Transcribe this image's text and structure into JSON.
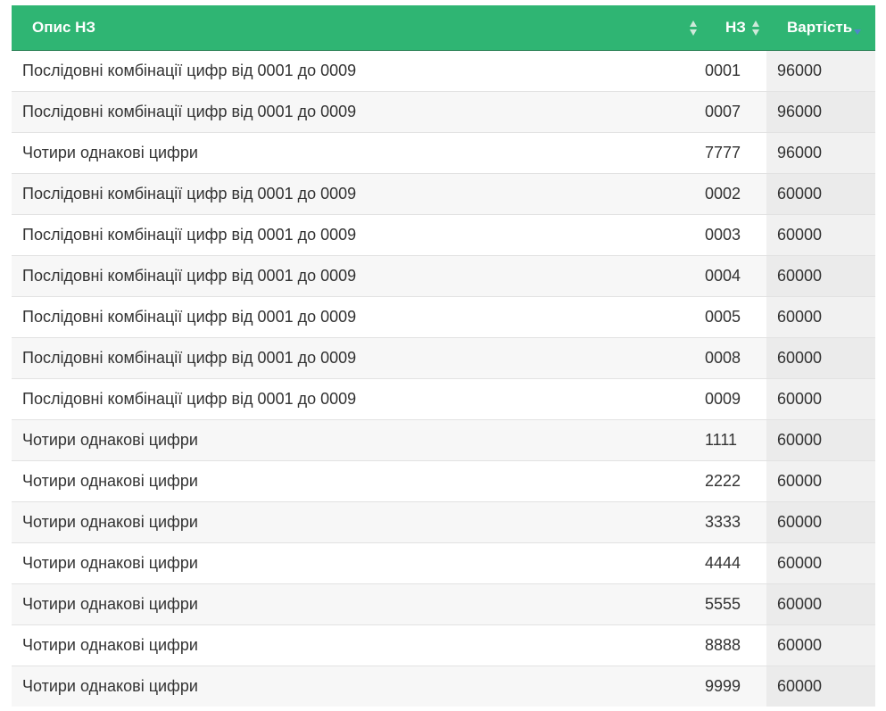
{
  "table": {
    "headers": {
      "description": "Опис НЗ",
      "nz": "НЗ",
      "cost": "Вартість"
    },
    "sort": {
      "column": "cost",
      "direction": "descending"
    },
    "colors": {
      "header_background": "#2fb573",
      "header_text": "#ffffff",
      "active_sort_arrow": "#4f86c9"
    },
    "rows": [
      {
        "description": "Послідовні комбінації цифр від 0001 до 0009",
        "nz": "0001",
        "cost": "96000"
      },
      {
        "description": "Послідовні комбінації цифр від 0001 до 0009",
        "nz": "0007",
        "cost": "96000"
      },
      {
        "description": "Чотири однакові цифри",
        "nz": "7777",
        "cost": "96000"
      },
      {
        "description": "Послідовні комбінації цифр від 0001 до 0009",
        "nz": "0002",
        "cost": "60000"
      },
      {
        "description": "Послідовні комбінації цифр від 0001 до 0009",
        "nz": "0003",
        "cost": "60000"
      },
      {
        "description": "Послідовні комбінації цифр від 0001 до 0009",
        "nz": "0004",
        "cost": "60000"
      },
      {
        "description": "Послідовні комбінації цифр від 0001 до 0009",
        "nz": "0005",
        "cost": "60000"
      },
      {
        "description": "Послідовні комбінації цифр від 0001 до 0009",
        "nz": "0008",
        "cost": "60000"
      },
      {
        "description": "Послідовні комбінації цифр від 0001 до 0009",
        "nz": "0009",
        "cost": "60000"
      },
      {
        "description": "Чотири однакові цифри",
        "nz": "1111",
        "cost": "60000"
      },
      {
        "description": "Чотири однакові цифри",
        "nz": "2222",
        "cost": "60000"
      },
      {
        "description": "Чотири однакові цифри",
        "nz": "3333",
        "cost": "60000"
      },
      {
        "description": "Чотири однакові цифри",
        "nz": "4444",
        "cost": "60000"
      },
      {
        "description": "Чотири однакові цифри",
        "nz": "5555",
        "cost": "60000"
      },
      {
        "description": "Чотири однакові цифри",
        "nz": "8888",
        "cost": "60000"
      },
      {
        "description": "Чотири однакові цифри",
        "nz": "9999",
        "cost": "60000"
      }
    ]
  }
}
